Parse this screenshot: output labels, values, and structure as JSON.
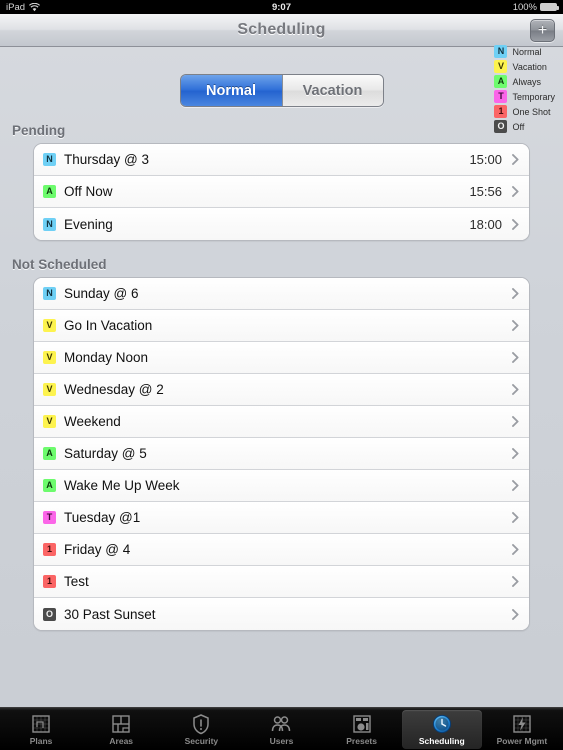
{
  "statusbar": {
    "device": "iPad",
    "wifi_icon": "wifi-icon",
    "time": "9:07",
    "battery_percent": "100%",
    "battery_icon": "battery-icon"
  },
  "navbar": {
    "title": "Scheduling",
    "add_label": "+",
    "add_icon": "plus-icon"
  },
  "legend": {
    "items": [
      {
        "letter": "N",
        "label": "Normal",
        "color": "#6fd0f5",
        "text": "#12323f"
      },
      {
        "letter": "V",
        "label": "Vacation",
        "color": "#fdf34f",
        "text": "#3a3602"
      },
      {
        "letter": "A",
        "label": "Always",
        "color": "#6dfb6d",
        "text": "#0c3a0c"
      },
      {
        "letter": "T",
        "label": "Temporary",
        "color": "#fb66e8",
        "text": "#3d0a36"
      },
      {
        "letter": "1",
        "label": "One Shot",
        "color": "#fb6565",
        "text": "#450d0d"
      },
      {
        "letter": "O",
        "label": "Off",
        "color": "#4b4b4b",
        "text": "#f2f2f2"
      }
    ]
  },
  "segmented": {
    "options": [
      "Normal",
      "Vacation"
    ],
    "selected": "Normal"
  },
  "sections": [
    {
      "header": "Pending",
      "rows": [
        {
          "letter": "N",
          "color": "#6fd0f5",
          "text": "#12323f",
          "title": "Thursday @ 3",
          "time": "15:00"
        },
        {
          "letter": "A",
          "color": "#6dfb6d",
          "text": "#0c3a0c",
          "title": "Off Now",
          "time": "15:56"
        },
        {
          "letter": "N",
          "color": "#6fd0f5",
          "text": "#12323f",
          "title": "Evening",
          "time": "18:00"
        }
      ]
    },
    {
      "header": "Not Scheduled",
      "rows": [
        {
          "letter": "N",
          "color": "#6fd0f5",
          "text": "#12323f",
          "title": "Sunday @ 6",
          "time": ""
        },
        {
          "letter": "V",
          "color": "#fdf34f",
          "text": "#3a3602",
          "title": "Go In Vacation",
          "time": ""
        },
        {
          "letter": "V",
          "color": "#fdf34f",
          "text": "#3a3602",
          "title": "Monday Noon",
          "time": ""
        },
        {
          "letter": "V",
          "color": "#fdf34f",
          "text": "#3a3602",
          "title": "Wednesday @ 2",
          "time": ""
        },
        {
          "letter": "V",
          "color": "#fdf34f",
          "text": "#3a3602",
          "title": "Weekend",
          "time": ""
        },
        {
          "letter": "A",
          "color": "#6dfb6d",
          "text": "#0c3a0c",
          "title": "Saturday @ 5",
          "time": ""
        },
        {
          "letter": "A",
          "color": "#6dfb6d",
          "text": "#0c3a0c",
          "title": "Wake Me Up Week",
          "time": ""
        },
        {
          "letter": "T",
          "color": "#fb66e8",
          "text": "#3d0a36",
          "title": "Tuesday @1",
          "time": ""
        },
        {
          "letter": "1",
          "color": "#fb6565",
          "text": "#450d0d",
          "title": "Friday @ 4",
          "time": ""
        },
        {
          "letter": "1",
          "color": "#fb6565",
          "text": "#450d0d",
          "title": "Test",
          "time": ""
        },
        {
          "letter": "O",
          "color": "#4b4b4b",
          "text": "#f2f2f2",
          "title": "30 Past Sunset",
          "time": ""
        }
      ]
    }
  ],
  "tabbar": {
    "tabs": [
      {
        "label": "Plans",
        "icon": "floorplan-grid-icon",
        "active": false
      },
      {
        "label": "Areas",
        "icon": "floorplan-rooms-icon",
        "active": false
      },
      {
        "label": "Security",
        "icon": "shield-alert-icon",
        "active": false
      },
      {
        "label": "Users",
        "icon": "users-icon",
        "active": false
      },
      {
        "label": "Presets",
        "icon": "preset-panel-icon",
        "active": false
      },
      {
        "label": "Scheduling",
        "icon": "clock-icon",
        "active": true
      },
      {
        "label": "Power Mgmt",
        "icon": "power-bolt-icon",
        "active": false
      }
    ]
  },
  "colors": {
    "accent": "#2463cf",
    "page_bg": "#cfd3d9"
  }
}
